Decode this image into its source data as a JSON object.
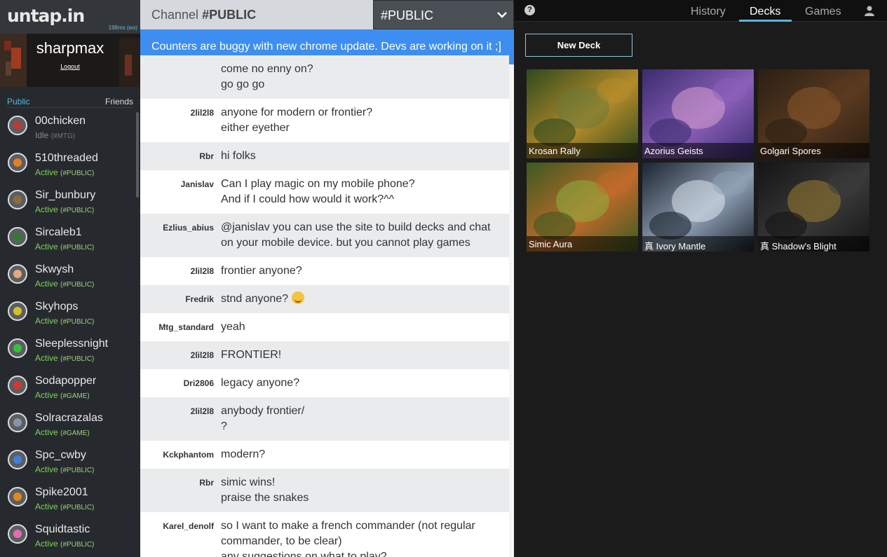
{
  "sidebar": {
    "logo": "untap.in",
    "latency": "198ms (ws)",
    "username": "sharpmax",
    "logout_label": "Logout",
    "tabs": {
      "public": "Public",
      "friends": "Friends"
    },
    "users": [
      {
        "name": "00chicken",
        "status": "Idle",
        "channel": "(#MTG)",
        "idle": true,
        "color": "#c0392b"
      },
      {
        "name": "510threaded",
        "status": "Active",
        "channel": "(#PUBLIC)",
        "idle": false,
        "color": "#e67e22"
      },
      {
        "name": "Sir_bunbury",
        "status": "Active",
        "channel": "(#PUBLIC)",
        "idle": false,
        "color": "#8e6b3a"
      },
      {
        "name": "Sircaleb1",
        "status": "Active",
        "channel": "(#PUBLIC)",
        "idle": false,
        "color": "#2e7d32"
      },
      {
        "name": "Skwysh",
        "status": "Active",
        "channel": "(#PUBLIC)",
        "idle": false,
        "color": "#e6a77a"
      },
      {
        "name": "Skyhops",
        "status": "Active",
        "channel": "(#PUBLIC)",
        "idle": false,
        "color": "#d4c02a"
      },
      {
        "name": "Sleeplessnight",
        "status": "Active",
        "channel": "(#PUBLIC)",
        "idle": false,
        "color": "#3bbf3b"
      },
      {
        "name": "Sodapopper",
        "status": "Active",
        "channel": "(#GAME)",
        "idle": false,
        "color": "#d9362b"
      },
      {
        "name": "Solracrazalas",
        "status": "Active",
        "channel": "(#GAME)",
        "idle": false,
        "color": "#8a93a8"
      },
      {
        "name": "Spc_cwby",
        "status": "Active",
        "channel": "(#PUBLIC)",
        "idle": false,
        "color": "#3f7fd6"
      },
      {
        "name": "Spike2001",
        "status": "Active",
        "channel": "(#PUBLIC)",
        "idle": false,
        "color": "#e08a1e"
      },
      {
        "name": "Squidtastic",
        "status": "Active",
        "channel": "(#PUBLIC)",
        "idle": false,
        "color": "#e56bb0"
      }
    ]
  },
  "chat": {
    "channel_prefix": "Channel ",
    "channel_name": "#PUBLIC",
    "select_value": "#PUBLIC",
    "banner": "Counters are buggy with new chrome update. Devs are working on it ;]",
    "messages": [
      {
        "user": "",
        "lines": [
          "come no enny on?",
          "go go go"
        ],
        "style": "alt"
      },
      {
        "user": "2lil2l8",
        "lines": [
          "anyone for modern or frontier?",
          "either eyether"
        ],
        "style": "plain"
      },
      {
        "user": "Rbr",
        "lines": [
          "hi folks"
        ],
        "style": "alt"
      },
      {
        "user": "Janislav",
        "lines": [
          "Can I play magic on my mobile phone?",
          "And if I could how would it work?^^"
        ],
        "style": "plain"
      },
      {
        "user": "Ezlius_abius",
        "lines": [
          "@janislav you can use the site to build decks and chat",
          "on your mobile device. but you cannot play games"
        ],
        "style": "alt"
      },
      {
        "user": "2lil2l8",
        "lines": [
          "frontier anyone?"
        ],
        "style": "plain"
      },
      {
        "user": "Fredrik",
        "lines": [
          "stnd anyone?"
        ],
        "style": "alt",
        "emoji": "smile"
      },
      {
        "user": "Mtg_standard",
        "lines": [
          "yeah"
        ],
        "style": "plain"
      },
      {
        "user": "2lil2l8",
        "lines": [
          "FRONTIER!"
        ],
        "style": "alt"
      },
      {
        "user": "Dri2806",
        "lines": [
          "legacy anyone?"
        ],
        "style": "plain"
      },
      {
        "user": "2lil2l8",
        "lines": [
          "anybody frontier/",
          "?"
        ],
        "style": "alt"
      },
      {
        "user": "Kckphantom",
        "lines": [
          "modern?"
        ],
        "style": "plain"
      },
      {
        "user": "Rbr",
        "lines": [
          "simic wins!",
          "praise the snakes"
        ],
        "style": "alt"
      },
      {
        "user": "Karel_denolf",
        "lines": [
          "so I want to make a french commander (not regular",
          "commander, to be clear)",
          "any suggestions on what to play?"
        ],
        "style": "plain"
      }
    ]
  },
  "right": {
    "help_icon": "?",
    "tabs": [
      "History",
      "Decks",
      "Games"
    ],
    "active_tab": "Decks",
    "new_deck_label": "New Deck",
    "decks": [
      {
        "name": "Krosan Rally",
        "colors": [
          "#2f4a1e",
          "#b58b2a",
          "#6a7a3a"
        ]
      },
      {
        "name": "Azorius Geists",
        "colors": [
          "#3a2c6e",
          "#8a5fb8",
          "#d9a0d0"
        ]
      },
      {
        "name": "Golgari Spores",
        "colors": [
          "#2a1f14",
          "#5a3a20",
          "#8a5a2a"
        ]
      },
      {
        "name": "Simic Aura",
        "colors": [
          "#3a5a20",
          "#c06a2a",
          "#8ab040"
        ]
      },
      {
        "name": "真 Ivory Mantle",
        "colors": [
          "#1c2430",
          "#8fa0b4",
          "#dfe6ee"
        ]
      },
      {
        "name": "真 Shadow's Blight",
        "colors": [
          "#141414",
          "#3a3a3a",
          "#9a7a30"
        ]
      }
    ]
  }
}
